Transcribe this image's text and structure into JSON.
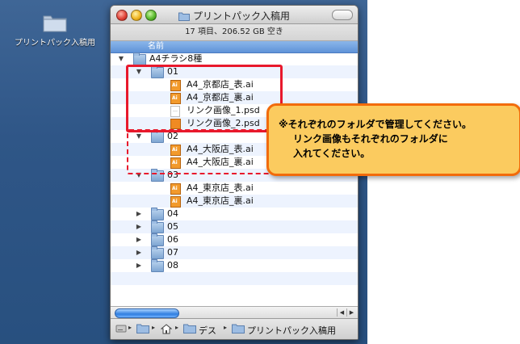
{
  "desktop": {
    "icon_label": "プリントパック入稿用",
    "icon": "folder-icon"
  },
  "window": {
    "title": "プリントパック入稿用",
    "status": "17 項目、206.52 GB 空き",
    "column_header": "名前"
  },
  "rows": [
    {
      "name": "A4チラシ8種",
      "type": "folder",
      "indent": 0,
      "disclosure": "▼"
    },
    {
      "name": "01",
      "type": "folder",
      "indent": 1,
      "disclosure": "▼"
    },
    {
      "name": "A4_京都店_表.ai",
      "type": "ai",
      "indent": 2,
      "disclosure": ""
    },
    {
      "name": "A4_京都店_裏.ai",
      "type": "ai",
      "indent": 2,
      "disclosure": ""
    },
    {
      "name": "リンク画像_1.psd",
      "type": "doc",
      "indent": 2,
      "disclosure": ""
    },
    {
      "name": "リンク画像_2.psd",
      "type": "psd2",
      "indent": 2,
      "disclosure": ""
    },
    {
      "name": "02",
      "type": "folder",
      "indent": 1,
      "disclosure": "▼"
    },
    {
      "name": "A4_大阪店_表.ai",
      "type": "ai",
      "indent": 2,
      "disclosure": ""
    },
    {
      "name": "A4_大阪店_裏.ai",
      "type": "ai",
      "indent": 2,
      "disclosure": ""
    },
    {
      "name": "03",
      "type": "folder",
      "indent": 1,
      "disclosure": "▼"
    },
    {
      "name": "A4_東京店_表.ai",
      "type": "ai",
      "indent": 2,
      "disclosure": ""
    },
    {
      "name": "A4_東京店_裏.ai",
      "type": "ai",
      "indent": 2,
      "disclosure": ""
    },
    {
      "name": "04",
      "type": "folder",
      "indent": 1,
      "disclosure": "▶"
    },
    {
      "name": "05",
      "type": "folder",
      "indent": 1,
      "disclosure": "▶"
    },
    {
      "name": "06",
      "type": "folder",
      "indent": 1,
      "disclosure": "▶"
    },
    {
      "name": "07",
      "type": "folder",
      "indent": 1,
      "disclosure": "▶"
    },
    {
      "name": "08",
      "type": "folder",
      "indent": 1,
      "disclosure": "▶"
    },
    {
      "name": "",
      "type": "blank",
      "indent": 0,
      "disclosure": ""
    },
    {
      "name": "",
      "type": "blank",
      "indent": 0,
      "disclosure": ""
    }
  ],
  "pathbar": {
    "items": [
      "デス",
      "プリントパック入稿用"
    ],
    "separator": "▸"
  },
  "callout": {
    "line1": "※それぞれのフォルダで管理してください。",
    "line2": "リンク画像もそれぞれのフォルダに",
    "line3": "入れてください。"
  },
  "colors": {
    "highlight_red": "#e8192c",
    "callout_fill": "#fbcb5f",
    "callout_border": "#f26b0a",
    "header_blue": "#5f93d8"
  }
}
